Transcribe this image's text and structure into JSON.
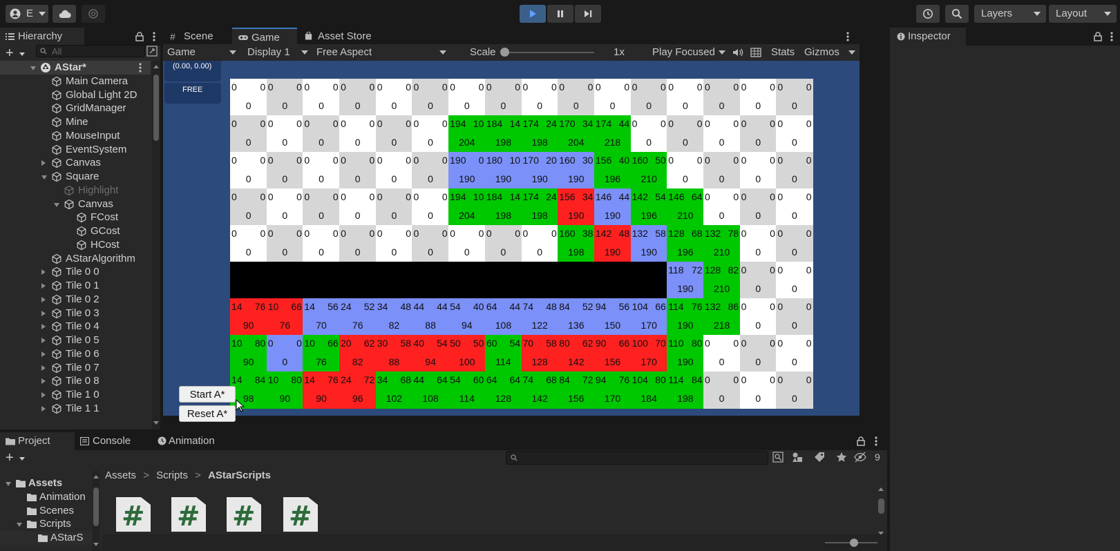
{
  "toolbar": {
    "account_label": "E",
    "layers_label": "Layers",
    "layout_label": "Layout"
  },
  "hierarchy": {
    "tab_label": "Hierarchy",
    "search_placeholder": "All",
    "items": [
      {
        "label": "AStar*",
        "depth": 0,
        "arrow": "down",
        "icon": "unity-scene-icon",
        "bold": true
      },
      {
        "label": "Main Camera",
        "depth": 1,
        "arrow": "none",
        "icon": "cube-icon"
      },
      {
        "label": "Global Light 2D",
        "depth": 1,
        "arrow": "none",
        "icon": "cube-icon"
      },
      {
        "label": "GridManager",
        "depth": 1,
        "arrow": "none",
        "icon": "cube-icon"
      },
      {
        "label": "Mine",
        "depth": 1,
        "arrow": "none",
        "icon": "cube-icon"
      },
      {
        "label": "MouseInput",
        "depth": 1,
        "arrow": "none",
        "icon": "cube-icon"
      },
      {
        "label": "EventSystem",
        "depth": 1,
        "arrow": "none",
        "icon": "cube-icon"
      },
      {
        "label": "Canvas",
        "depth": 1,
        "arrow": "right",
        "icon": "cube-icon"
      },
      {
        "label": "Square",
        "depth": 1,
        "arrow": "down",
        "icon": "cube-icon"
      },
      {
        "label": "Highlight",
        "depth": 2,
        "arrow": "none",
        "icon": "cube-icon",
        "disabled": true
      },
      {
        "label": "Canvas",
        "depth": 2,
        "arrow": "down",
        "icon": "cube-icon"
      },
      {
        "label": "FCost",
        "depth": 3,
        "arrow": "none",
        "icon": "cube-icon"
      },
      {
        "label": "GCost",
        "depth": 3,
        "arrow": "none",
        "icon": "cube-icon"
      },
      {
        "label": "HCost",
        "depth": 3,
        "arrow": "none",
        "icon": "cube-icon"
      },
      {
        "label": "AStarAlgorithm",
        "depth": 1,
        "arrow": "none",
        "icon": "cube-icon"
      },
      {
        "label": "Tile 0 0",
        "depth": 1,
        "arrow": "right",
        "icon": "cube-icon"
      },
      {
        "label": "Tile 0 1",
        "depth": 1,
        "arrow": "right",
        "icon": "cube-icon"
      },
      {
        "label": "Tile 0 2",
        "depth": 1,
        "arrow": "right",
        "icon": "cube-icon"
      },
      {
        "label": "Tile 0 3",
        "depth": 1,
        "arrow": "right",
        "icon": "cube-icon"
      },
      {
        "label": "Tile 0 4",
        "depth": 1,
        "arrow": "right",
        "icon": "cube-icon"
      },
      {
        "label": "Tile 0 5",
        "depth": 1,
        "arrow": "right",
        "icon": "cube-icon"
      },
      {
        "label": "Tile 0 6",
        "depth": 1,
        "arrow": "right",
        "icon": "cube-icon"
      },
      {
        "label": "Tile 0 7",
        "depth": 1,
        "arrow": "right",
        "icon": "cube-icon"
      },
      {
        "label": "Tile 0 8",
        "depth": 1,
        "arrow": "right",
        "icon": "cube-icon"
      },
      {
        "label": "Tile 1 0",
        "depth": 1,
        "arrow": "right",
        "icon": "cube-icon"
      },
      {
        "label": "Tile 1 1",
        "depth": 1,
        "arrow": "right",
        "icon": "cube-icon"
      }
    ]
  },
  "scene_tabs": {
    "scene": "Scene",
    "game": "Game",
    "asset_store": "Asset Store"
  },
  "game_toolbar": {
    "game_dropdown": "Game",
    "display": "Display 1",
    "aspect": "Free Aspect",
    "scale_label": "Scale",
    "scale_value": "1x",
    "scale_fraction": 0.0,
    "play_focused": "Play Focused",
    "stats": "Stats",
    "gizmos": "Gizmos"
  },
  "game_overlay": {
    "coords": "(0.00, 0.00)",
    "mode": "FREE",
    "start_button": "Start A*",
    "reset_button": "Reset A*"
  },
  "grid": {
    "colors": {
      "w": "#ffffff",
      "s": "#d6d6d6",
      "g": "#00c800",
      "b": "#7b90f8",
      "r": "#ff2020",
      "k": "#000000"
    },
    "rows": [
      [
        [
          "w",
          "0",
          "0",
          "0"
        ],
        [
          "s",
          "0",
          "0",
          "0"
        ],
        [
          "w",
          "0",
          "0",
          "0"
        ],
        [
          "s",
          "0",
          "0",
          "0"
        ],
        [
          "w",
          "0",
          "0",
          "0"
        ],
        [
          "s",
          "0",
          "0",
          "0"
        ],
        [
          "w",
          "0",
          "0",
          "0"
        ],
        [
          "s",
          "0",
          "0",
          "0"
        ],
        [
          "w",
          "0",
          "0",
          "0"
        ],
        [
          "s",
          "0",
          "0",
          "0"
        ],
        [
          "w",
          "0",
          "0",
          "0"
        ],
        [
          "s",
          "0",
          "0",
          "0"
        ],
        [
          "w",
          "0",
          "0",
          "0"
        ],
        [
          "s",
          "0",
          "0",
          "0"
        ],
        [
          "w",
          "0",
          "0",
          "0"
        ],
        [
          "s",
          "0",
          "0",
          "0"
        ]
      ],
      [
        [
          "s",
          "0",
          "0",
          "0"
        ],
        [
          "w",
          "0",
          "0",
          "0"
        ],
        [
          "s",
          "0",
          "0",
          "0"
        ],
        [
          "w",
          "0",
          "0",
          "0"
        ],
        [
          "s",
          "0",
          "0",
          "0"
        ],
        [
          "w",
          "0",
          "0",
          "0"
        ],
        [
          "g",
          "194",
          "10",
          "204"
        ],
        [
          "g",
          "184",
          "14",
          "198"
        ],
        [
          "g",
          "174",
          "24",
          "198"
        ],
        [
          "g",
          "170",
          "34",
          "204"
        ],
        [
          "g",
          "174",
          "44",
          "218"
        ],
        [
          "w",
          "0",
          "0",
          "0"
        ],
        [
          "s",
          "0",
          "0",
          "0"
        ],
        [
          "w",
          "0",
          "0",
          "0"
        ],
        [
          "s",
          "0",
          "0",
          "0"
        ],
        [
          "w",
          "0",
          "0",
          "0"
        ]
      ],
      [
        [
          "w",
          "0",
          "0",
          "0"
        ],
        [
          "s",
          "0",
          "0",
          "0"
        ],
        [
          "w",
          "0",
          "0",
          "0"
        ],
        [
          "s",
          "0",
          "0",
          "0"
        ],
        [
          "w",
          "0",
          "0",
          "0"
        ],
        [
          "s",
          "0",
          "0",
          "0"
        ],
        [
          "b",
          "190",
          "0",
          "190"
        ],
        [
          "b",
          "180",
          "10",
          "190"
        ],
        [
          "b",
          "170",
          "20",
          "190"
        ],
        [
          "b",
          "160",
          "30",
          "190"
        ],
        [
          "g",
          "156",
          "40",
          "196"
        ],
        [
          "g",
          "160",
          "50",
          "210"
        ],
        [
          "w",
          "0",
          "0",
          "0"
        ],
        [
          "s",
          "0",
          "0",
          "0"
        ],
        [
          "w",
          "0",
          "0",
          "0"
        ],
        [
          "s",
          "0",
          "0",
          "0"
        ]
      ],
      [
        [
          "s",
          "0",
          "0",
          "0"
        ],
        [
          "w",
          "0",
          "0",
          "0"
        ],
        [
          "s",
          "0",
          "0",
          "0"
        ],
        [
          "w",
          "0",
          "0",
          "0"
        ],
        [
          "s",
          "0",
          "0",
          "0"
        ],
        [
          "w",
          "0",
          "0",
          "0"
        ],
        [
          "g",
          "194",
          "10",
          "204"
        ],
        [
          "g",
          "184",
          "14",
          "198"
        ],
        [
          "g",
          "174",
          "24",
          "198"
        ],
        [
          "r",
          "156",
          "34",
          "190"
        ],
        [
          "b",
          "146",
          "44",
          "190"
        ],
        [
          "g",
          "142",
          "54",
          "196"
        ],
        [
          "g",
          "146",
          "64",
          "210"
        ],
        [
          "w",
          "0",
          "0",
          "0"
        ],
        [
          "s",
          "0",
          "0",
          "0"
        ],
        [
          "w",
          "0",
          "0",
          "0"
        ]
      ],
      [
        [
          "w",
          "0",
          "0",
          "0"
        ],
        [
          "s",
          "0",
          "0",
          "0"
        ],
        [
          "w",
          "0",
          "0",
          "0"
        ],
        [
          "s",
          "0",
          "0",
          "0"
        ],
        [
          "w",
          "0",
          "0",
          "0"
        ],
        [
          "s",
          "0",
          "0",
          "0"
        ],
        [
          "w",
          "0",
          "0",
          "0"
        ],
        [
          "s",
          "0",
          "0",
          "0"
        ],
        [
          "w",
          "0",
          "0",
          "0"
        ],
        [
          "g",
          "160",
          "38",
          "198"
        ],
        [
          "r",
          "142",
          "48",
          "190"
        ],
        [
          "b",
          "132",
          "58",
          "190"
        ],
        [
          "g",
          "128",
          "68",
          "196"
        ],
        [
          "g",
          "132",
          "78",
          "210"
        ],
        [
          "w",
          "0",
          "0",
          "0"
        ],
        [
          "s",
          "0",
          "0",
          "0"
        ]
      ],
      [
        [
          "k",
          "",
          "",
          ""
        ],
        [
          "k",
          "",
          "",
          ""
        ],
        [
          "k",
          "",
          "",
          ""
        ],
        [
          "k",
          "",
          "",
          ""
        ],
        [
          "k",
          "",
          "",
          ""
        ],
        [
          "k",
          "",
          "",
          ""
        ],
        [
          "k",
          "",
          "",
          ""
        ],
        [
          "k",
          "",
          "",
          ""
        ],
        [
          "k",
          "",
          "",
          ""
        ],
        [
          "k",
          "",
          "",
          ""
        ],
        [
          "k",
          "",
          "",
          ""
        ],
        [
          "k",
          "",
          "",
          ""
        ],
        [
          "b",
          "118",
          "72",
          "190"
        ],
        [
          "g",
          "128",
          "82",
          "210"
        ],
        [
          "s",
          "0",
          "0",
          "0"
        ],
        [
          "w",
          "0",
          "0",
          "0"
        ]
      ],
      [
        [
          "r",
          "14",
          "76",
          "90"
        ],
        [
          "r",
          "10",
          "66",
          "76"
        ],
        [
          "b",
          "14",
          "56",
          "70"
        ],
        [
          "b",
          "24",
          "52",
          "76"
        ],
        [
          "b",
          "34",
          "48",
          "82"
        ],
        [
          "b",
          "44",
          "44",
          "88"
        ],
        [
          "b",
          "54",
          "40",
          "94"
        ],
        [
          "b",
          "64",
          "44",
          "108"
        ],
        [
          "b",
          "74",
          "48",
          "122"
        ],
        [
          "b",
          "84",
          "52",
          "136"
        ],
        [
          "b",
          "94",
          "56",
          "150"
        ],
        [
          "b",
          "104",
          "66",
          "170"
        ],
        [
          "g",
          "114",
          "76",
          "190"
        ],
        [
          "g",
          "132",
          "86",
          "218"
        ],
        [
          "w",
          "0",
          "0",
          "0"
        ],
        [
          "s",
          "0",
          "0",
          "0"
        ]
      ],
      [
        [
          "g",
          "10",
          "80",
          "90"
        ],
        [
          "b",
          "0",
          "0",
          "0"
        ],
        [
          "g",
          "10",
          "66",
          "76"
        ],
        [
          "r",
          "20",
          "62",
          "82"
        ],
        [
          "r",
          "30",
          "58",
          "88"
        ],
        [
          "r",
          "40",
          "54",
          "94"
        ],
        [
          "r",
          "50",
          "50",
          "100"
        ],
        [
          "g",
          "60",
          "54",
          "114"
        ],
        [
          "r",
          "70",
          "58",
          "128"
        ],
        [
          "r",
          "80",
          "62",
          "142"
        ],
        [
          "r",
          "90",
          "66",
          "156"
        ],
        [
          "r",
          "100",
          "70",
          "170"
        ],
        [
          "g",
          "110",
          "80",
          "190"
        ],
        [
          "w",
          "0",
          "0",
          "0"
        ],
        [
          "s",
          "0",
          "0",
          "0"
        ],
        [
          "w",
          "0",
          "0",
          "0"
        ]
      ],
      [
        [
          "g",
          "14",
          "84",
          "98"
        ],
        [
          "g",
          "10",
          "80",
          "90"
        ],
        [
          "r",
          "14",
          "76",
          "90"
        ],
        [
          "r",
          "24",
          "72",
          "96"
        ],
        [
          "g",
          "34",
          "68",
          "102"
        ],
        [
          "g",
          "44",
          "64",
          "108"
        ],
        [
          "g",
          "54",
          "60",
          "114"
        ],
        [
          "g",
          "64",
          "64",
          "128"
        ],
        [
          "g",
          "74",
          "68",
          "142"
        ],
        [
          "g",
          "84",
          "72",
          "156"
        ],
        [
          "g",
          "94",
          "76",
          "170"
        ],
        [
          "g",
          "104",
          "80",
          "184"
        ],
        [
          "g",
          "114",
          "84",
          "198"
        ],
        [
          "s",
          "0",
          "0",
          "0"
        ],
        [
          "w",
          "0",
          "0",
          "0"
        ],
        [
          "s",
          "0",
          "0",
          "0"
        ]
      ]
    ]
  },
  "inspector": {
    "tab_label": "Inspector"
  },
  "bottom_tabs": {
    "project": "Project",
    "console": "Console",
    "animation": "Animation"
  },
  "project": {
    "hidden_count": "9",
    "breadcrumb": [
      "Assets",
      "Scripts",
      "AStarScripts"
    ],
    "tree": [
      {
        "label": "Assets",
        "depth": 0,
        "arrow": "down",
        "bold": true
      },
      {
        "label": "Animation",
        "depth": 1,
        "arrow": "none"
      },
      {
        "label": "Scenes",
        "depth": 1,
        "arrow": "none"
      },
      {
        "label": "Scripts",
        "depth": 1,
        "arrow": "down"
      },
      {
        "label": "AStarS",
        "depth": 2,
        "arrow": "none"
      }
    ],
    "file_glyph": "#"
  }
}
